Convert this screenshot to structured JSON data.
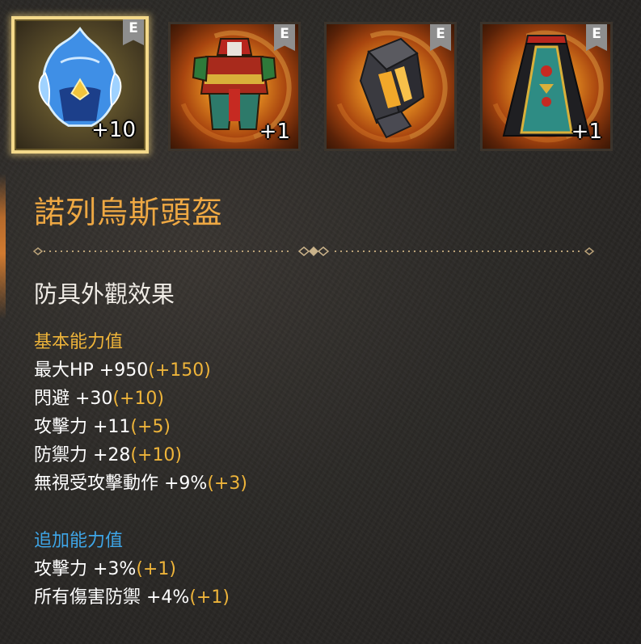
{
  "equipment_slots": [
    {
      "grade": "E",
      "level": "+10",
      "selected": true,
      "item": "helmet"
    },
    {
      "grade": "E",
      "level": "+1",
      "selected": false,
      "item": "armor"
    },
    {
      "grade": "E",
      "level": "",
      "selected": false,
      "item": "gauntlet"
    },
    {
      "grade": "E",
      "level": "+1",
      "selected": false,
      "item": "cape"
    }
  ],
  "item_name": "諾列烏斯頭盔",
  "section_heading": "防具外觀效果",
  "basic_stats": {
    "title": "基本能力值",
    "title_color": "#eeb43a",
    "lines": [
      {
        "label": "最大HP +950",
        "bonus": "(+150)"
      },
      {
        "label": "閃避 +30",
        "bonus": "(+10)"
      },
      {
        "label": "攻擊力 +11",
        "bonus": "(+5)"
      },
      {
        "label": "防禦力 +28",
        "bonus": "(+10)"
      },
      {
        "label": "無視受攻擊動作 +9%",
        "bonus": "(+3)"
      }
    ]
  },
  "additional_stats": {
    "title": "追加能力值",
    "title_color": "#3ea6e8",
    "lines": [
      {
        "label": "攻擊力 +3%",
        "bonus": "(+1)"
      },
      {
        "label": "所有傷害防禦 +4%",
        "bonus": "(+1)"
      }
    ]
  },
  "colors": {
    "item_name": "#eea843",
    "bonus": "#eeb43a",
    "grade_badge": "#8e8e8e",
    "selected_border": "#f4d98a"
  }
}
